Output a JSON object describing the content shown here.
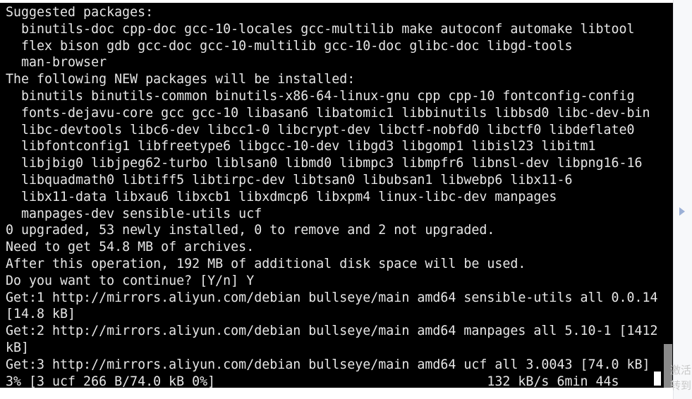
{
  "terminal": {
    "lines": [
      "Suggested packages:",
      "  binutils-doc cpp-doc gcc-10-locales gcc-multilib make autoconf automake libtool",
      "  flex bison gdb gcc-doc gcc-10-multilib gcc-10-doc glibc-doc libgd-tools",
      "  man-browser",
      "The following NEW packages will be installed:",
      "  binutils binutils-common binutils-x86-64-linux-gnu cpp cpp-10 fontconfig-config",
      "  fonts-dejavu-core gcc gcc-10 libasan6 libatomic1 libbinutils libbsd0 libc-dev-bin",
      "  libc-devtools libc6-dev libcc1-0 libcrypt-dev libctf-nobfd0 libctf0 libdeflate0",
      "  libfontconfig1 libfreetype6 libgcc-10-dev libgd3 libgomp1 libisl23 libitm1",
      "  libjbig0 libjpeg62-turbo liblsan0 libmd0 libmpc3 libmpfr6 libnsl-dev libpng16-16",
      "  libquadmath0 libtiff5 libtirpc-dev libtsan0 libubsan1 libwebp6 libx11-6",
      "  libx11-data libxau6 libxcb1 libxdmcp6 libxpm4 linux-libc-dev manpages",
      "  manpages-dev sensible-utils ucf",
      "0 upgraded, 53 newly installed, 0 to remove and 2 not upgraded.",
      "Need to get 54.8 MB of archives.",
      "After this operation, 192 MB of additional disk space will be used.",
      "Do you want to continue? [Y/n] Y",
      "Get:1 http://mirrors.aliyun.com/debian bullseye/main amd64 sensible-utils all 0.0.14",
      "[14.8 kB]",
      "Get:2 http://mirrors.aliyun.com/debian bullseye/main amd64 manpages all 5.10-1 [1412",
      "kB]",
      "Get:3 http://mirrors.aliyun.com/debian bullseye/main amd64 ucf all 3.0043 [74.0 kB]",
      "3% [3 ucf 266 B/74.0 kB 0%]                                   132 kB/s 6min 44s"
    ]
  },
  "side": {
    "watermark": "激活\n转到"
  },
  "colors": {
    "terminal_bg": "#000000",
    "terminal_fg": "#e6e6e6",
    "scroll_thumb": "#8a8a8a"
  }
}
